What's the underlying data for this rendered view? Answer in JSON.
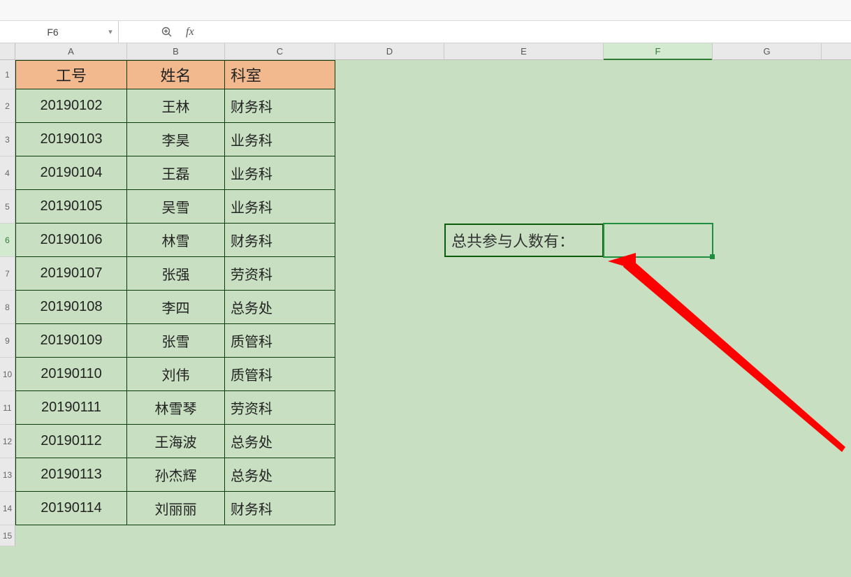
{
  "nameBox": "F6",
  "formula": "",
  "fxLabel": "fx",
  "columns": [
    "A",
    "B",
    "C",
    "D",
    "E",
    "F",
    "G"
  ],
  "activeColumn": "F",
  "activeRowIndex": 5,
  "rowNumbers": [
    1,
    2,
    3,
    4,
    5,
    6,
    7,
    8,
    9,
    10,
    11,
    12,
    13,
    14,
    15
  ],
  "headers": {
    "A": "工号",
    "B": "姓名",
    "C": "科室"
  },
  "rows": [
    {
      "id": "20190102",
      "name": "王林",
      "dept": "财务科"
    },
    {
      "id": "20190103",
      "name": "李昊",
      "dept": "业务科"
    },
    {
      "id": "20190104",
      "name": "王磊",
      "dept": "业务科"
    },
    {
      "id": "20190105",
      "name": "吴雪",
      "dept": "业务科"
    },
    {
      "id": "20190106",
      "name": "林雪",
      "dept": "财务科"
    },
    {
      "id": "20190107",
      "name": "张强",
      "dept": "劳资科"
    },
    {
      "id": "20190108",
      "name": "李四",
      "dept": "总务处"
    },
    {
      "id": "20190109",
      "name": "张雪",
      "dept": "质管科"
    },
    {
      "id": "20190110",
      "name": "刘伟",
      "dept": "质管科"
    },
    {
      "id": "20190111",
      "name": "林雪琴",
      "dept": "劳资科"
    },
    {
      "id": "20190112",
      "name": "王海波",
      "dept": "总务处"
    },
    {
      "id": "20190113",
      "name": "孙杰辉",
      "dept": "总务处"
    },
    {
      "id": "20190114",
      "name": "刘丽丽",
      "dept": "财务科"
    }
  ],
  "labelE6": "总共参与人数有：",
  "resultF6": ""
}
